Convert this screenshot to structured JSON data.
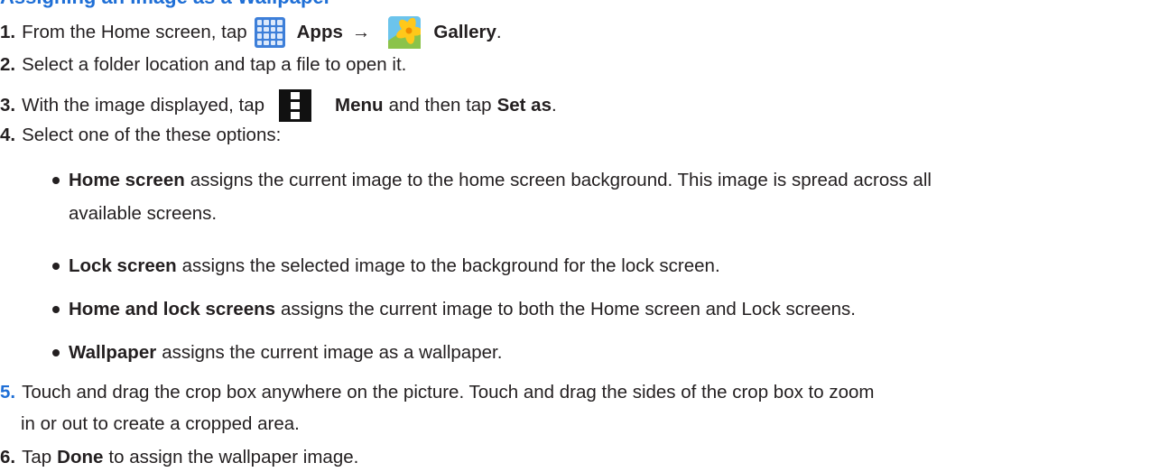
{
  "heading": "Assigning an Image as a Wallpaper",
  "steps": {
    "s1": {
      "num": "1.",
      "t1": "From the Home screen, tap",
      "apps": "Apps",
      "arrow": "→",
      "gallery": "Gallery",
      "end": "."
    },
    "s2": {
      "num": "2.",
      "text": "Select a folder location and tap a file to open it."
    },
    "s3": {
      "num": "3.",
      "t1": "With the image displayed, tap",
      "menu": "Menu",
      "t2": "and then tap",
      "setas": "Set as",
      "end": "."
    },
    "s4": {
      "num": "4.",
      "text": "Select one of the these options:"
    },
    "s5": {
      "num": "5.",
      "line1": "Touch and drag the crop box anywhere on the picture. Touch and drag the sides of the crop box to zoom",
      "line2": "in or out to create a cropped area."
    },
    "s6": {
      "num": "6.",
      "t1": "Tap",
      "done": "Done",
      "t2": "to assign the wallpaper image."
    }
  },
  "options": [
    {
      "title": "Home screen",
      "line1": "assigns the current image to the home screen background. This image is spread across all",
      "line2": "available screens."
    },
    {
      "title": "Lock screen",
      "line1": "assigns the selected image to the background for the lock screen."
    },
    {
      "title": "Home and lock screens",
      "line1": "assigns the current image to both the Home screen and Lock screens."
    },
    {
      "title": "Wallpaper",
      "line1": "assigns the current image as a wallpaper."
    }
  ],
  "icons": {
    "apps": "apps-grid-icon",
    "gallery": "gallery-flower-icon",
    "menu": "menu-dots-icon"
  },
  "colors": {
    "heading": "#1f6fd6",
    "text": "#231f20",
    "apps_icon": "#3d7fd9"
  }
}
